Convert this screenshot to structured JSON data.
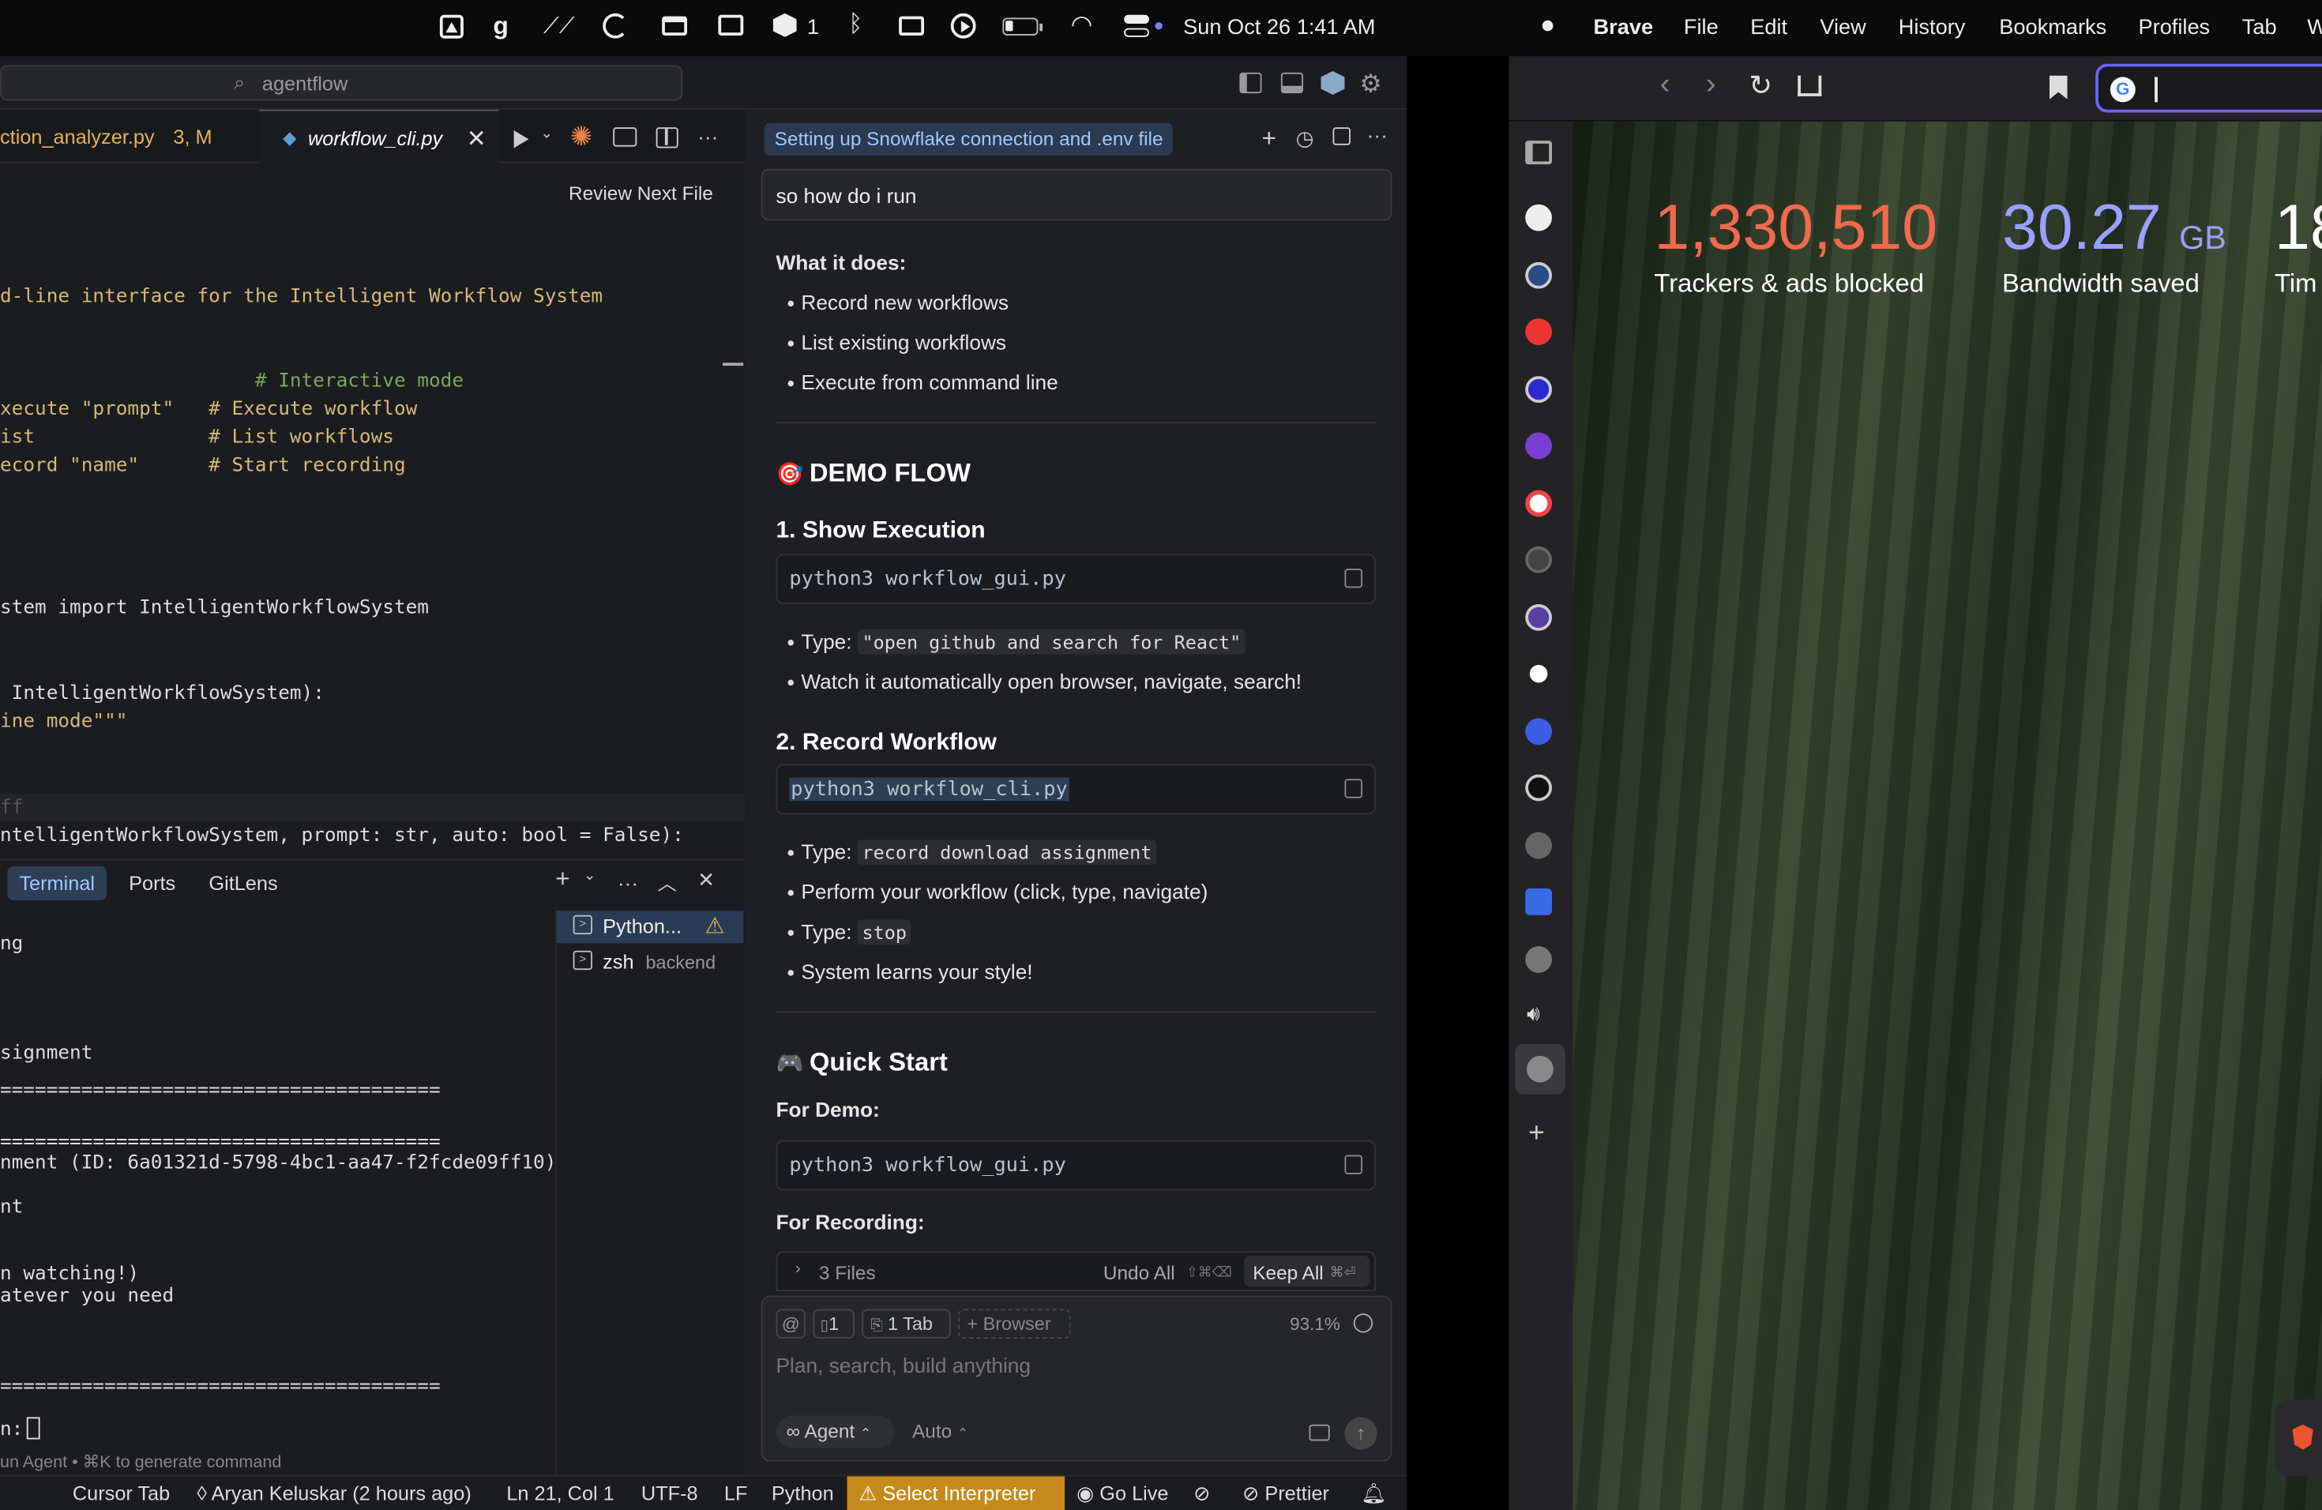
{
  "menubar": {
    "status_badge": "1",
    "datetime": "Sun Oct 26  1:41 AM",
    "brave_menus": [
      "Brave",
      "File",
      "Edit",
      "View",
      "History",
      "Bookmarks",
      "Profiles",
      "Tab",
      "W"
    ]
  },
  "editor": {
    "search_placeholder": "agentflow",
    "tabs": [
      {
        "label": "ction_analyzer.py",
        "badge": "3, M"
      },
      {
        "label": "workflow_cli.py"
      }
    ],
    "review_next": "Review Next File",
    "code": [
      "d-line interface for the Intelligent Workflow System",
      "                      # Interactive mode",
      "xecute \"prompt\"   # Execute workflow",
      "ist               # List workflows",
      "ecord \"name\"      # Start recording",
      "stem import IntelligentWorkflowSystem",
      " IntelligentWorkflowSystem):",
      "ine mode\"\"\"",
      "ff",
      "ntelligentWorkflowSystem, prompt: str, auto: bool = False):"
    ]
  },
  "panel": {
    "tabs": [
      "Terminal",
      "Ports",
      "GitLens"
    ],
    "terminals": [
      {
        "name": "Python...",
        "detail": ""
      },
      {
        "name": "zsh",
        "detail": "backend"
      }
    ],
    "lines": [
      "ng",
      "signment",
      "======================================",
      "======================================",
      "nment (ID: 6a01321d-5798-4bc1-aa47-f2fcde09ff10)",
      "nt",
      "n watching!)",
      "atever you need",
      "======================================",
      "n: ",
      "un Agent • ⌘K to generate command"
    ]
  },
  "chat": {
    "title_chip": "Setting up Snowflake connection and .env file",
    "user_msg": "so how do i run",
    "what_it_does": "What it does:",
    "what_items": [
      "Record new workflows",
      "List existing workflows",
      "Execute from command line"
    ],
    "demo_flow": "DEMO FLOW",
    "show_exec": "1. Show Execution",
    "cmd1": "python3 workflow_gui.py",
    "type_label": "Type:",
    "type1": "\"open github and search for React\"",
    "watch": "Watch it automatically open browser, navigate, search!",
    "record_wf": "2. Record Workflow",
    "cmd2": "python3 workflow_cli.py",
    "type2": "record download assignment",
    "perform": "Perform your workflow (click, type, navigate)",
    "type3": "stop",
    "learns": "System learns your style!",
    "quick_start": "Quick Start",
    "for_demo": "For Demo:",
    "cmd3": "python3 workflow_gui.py",
    "for_recording": "For Recording:",
    "files": "3 Files",
    "undo_all": "Undo All",
    "undo_kbd": "⇧⌘⌫",
    "keep_all": "Keep All",
    "keep_kbd": "⌘⏎",
    "ctx_count": "1",
    "ctx_tab": "1 Tab",
    "ctx_browser": "Browser",
    "ctx_pct": "93.1%",
    "input_placeholder": "Plan, search, build anything",
    "mode": "Agent",
    "model": "Auto"
  },
  "statusbar": {
    "cursor_tab": "Cursor Tab",
    "blame": "Aryan Keluskar (2 hours ago)",
    "position": "Ln 21, Col 1",
    "encoding": "UTF-8",
    "eol": "LF",
    "language": "Python",
    "interpreter": "Select Interpreter",
    "golive": "Go Live",
    "prettier": "Prettier"
  },
  "brave": {
    "stats": [
      {
        "value": "1,330,510",
        "unit": "",
        "label": "Trackers & ads blocked",
        "color": "#f06a4b"
      },
      {
        "value": "30.27",
        "unit": "GB",
        "label": "Bandwidth saved",
        "color": "#9aa0ff"
      },
      {
        "value": "18",
        "unit": "",
        "label": "Tim",
        "color": "#ffffff"
      }
    ]
  }
}
